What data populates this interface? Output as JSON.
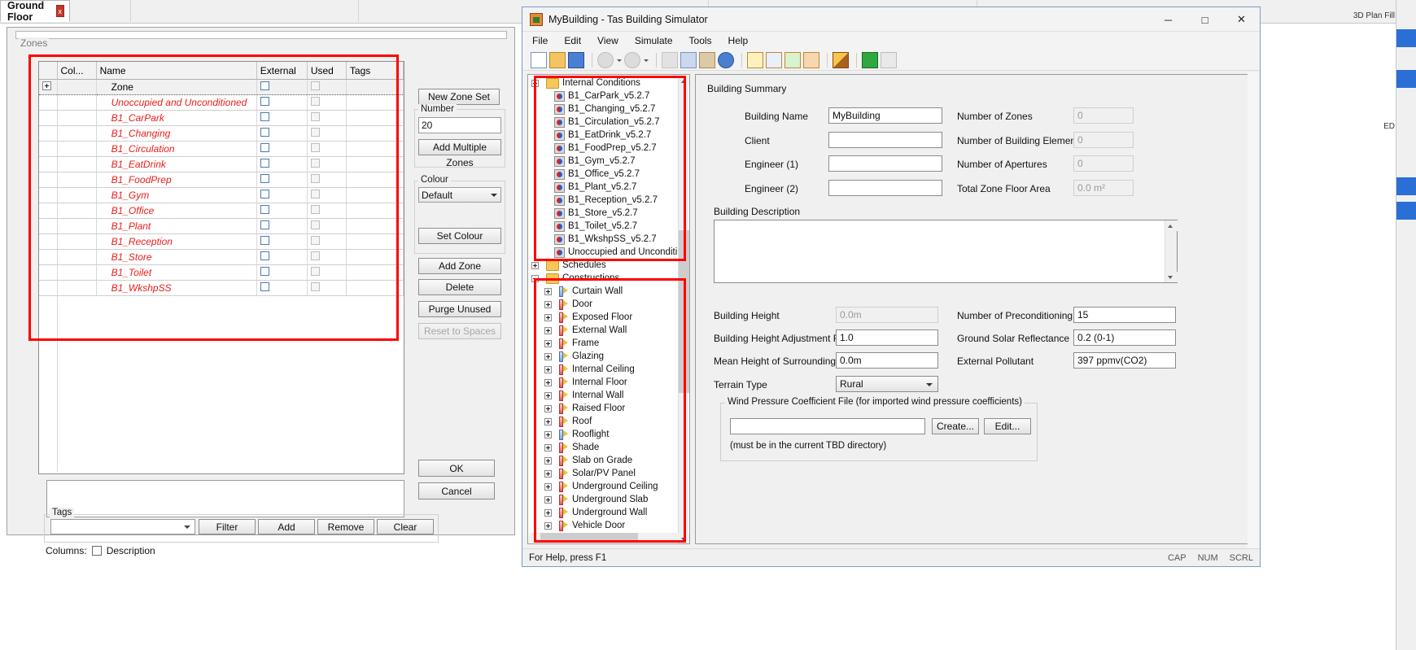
{
  "background": {
    "tab": {
      "label": "Ground Floor",
      "close_icon": "close-icon",
      "close_label": "x"
    },
    "right_strip": {
      "label_top": "3D Plan Fill",
      "label_mid": "ED"
    }
  },
  "zones_dialog": {
    "group_label": "Zones",
    "grid": {
      "columns": [
        "",
        "Col...",
        "Name",
        "External",
        "Used",
        "Tags"
      ],
      "rows": [
        {
          "name": "Zone",
          "root": true,
          "external": false,
          "used": false,
          "tags": ""
        },
        {
          "name": "Unoccupied and Unconditioned",
          "root": false,
          "external": false,
          "used": false,
          "tags": ""
        },
        {
          "name": "B1_CarPark",
          "root": false,
          "external": false,
          "used": false,
          "tags": ""
        },
        {
          "name": "B1_Changing",
          "root": false,
          "external": false,
          "used": false,
          "tags": ""
        },
        {
          "name": "B1_Circulation",
          "root": false,
          "external": false,
          "used": false,
          "tags": ""
        },
        {
          "name": "B1_EatDrink",
          "root": false,
          "external": false,
          "used": false,
          "tags": ""
        },
        {
          "name": "B1_FoodPrep",
          "root": false,
          "external": false,
          "used": false,
          "tags": ""
        },
        {
          "name": "B1_Gym",
          "root": false,
          "external": false,
          "used": false,
          "tags": ""
        },
        {
          "name": "B1_Office",
          "root": false,
          "external": false,
          "used": false,
          "tags": ""
        },
        {
          "name": "B1_Plant",
          "root": false,
          "external": false,
          "used": false,
          "tags": ""
        },
        {
          "name": "B1_Reception",
          "root": false,
          "external": false,
          "used": false,
          "tags": ""
        },
        {
          "name": "B1_Store",
          "root": false,
          "external": false,
          "used": false,
          "tags": ""
        },
        {
          "name": "B1_Toilet",
          "root": false,
          "external": false,
          "used": false,
          "tags": ""
        },
        {
          "name": "B1_WkshpSS",
          "root": false,
          "external": false,
          "used": false,
          "tags": ""
        }
      ]
    },
    "side": {
      "new_zone_set": "New Zone Set",
      "number_group": "Number",
      "number_value": "20",
      "add_multiple_zones": "Add Multiple Zones",
      "colour_group": "Colour",
      "colour_value": "Default",
      "set_colour": "Set Colour",
      "add_zone": "Add Zone",
      "delete": "Delete",
      "purge_unused": "Purge Unused",
      "reset_to_spaces": "Reset to Spaces",
      "ok": "OK",
      "cancel": "Cancel"
    },
    "tags": {
      "group_label": "Tags",
      "value": "",
      "filter": "Filter",
      "add": "Add",
      "remove": "Remove",
      "clear": "Clear"
    },
    "columns_row": {
      "label": "Columns:",
      "description": "Description",
      "checked": false
    }
  },
  "tas_window": {
    "title": "MyBuilding - Tas Building Simulator",
    "app_icon": "building-icon",
    "window_buttons": {
      "minimize": "─",
      "maximize": "□",
      "close": "✕"
    },
    "menu": [
      "File",
      "Edit",
      "View",
      "Simulate",
      "Tools",
      "Help"
    ],
    "toolbar_icons": [
      "new-document-icon",
      "open-folder-icon",
      "save-disk-icon",
      "back-arrow-icon",
      "forward-arrow-icon",
      "cut-scissors-icon",
      "copy-icon",
      "paste-icon",
      "help-globe-icon",
      "internal-conditions-icon",
      "schedule-edit-icon",
      "calendar-icon",
      "constructions-icon",
      "zones-icon",
      "building-3d-icon",
      "rotate-icon"
    ],
    "tree": {
      "nodes": [
        {
          "label": "Internal Conditions",
          "type": "folder",
          "expanded": true,
          "depth": 0
        },
        {
          "label": "B1_CarPark_v5.2.7",
          "type": "condition",
          "depth": 1
        },
        {
          "label": "B1_Changing_v5.2.7",
          "type": "condition",
          "depth": 1
        },
        {
          "label": "B1_Circulation_v5.2.7",
          "type": "condition",
          "depth": 1
        },
        {
          "label": "B1_EatDrink_v5.2.7",
          "type": "condition",
          "depth": 1
        },
        {
          "label": "B1_FoodPrep_v5.2.7",
          "type": "condition",
          "depth": 1
        },
        {
          "label": "B1_Gym_v5.2.7",
          "type": "condition",
          "depth": 1
        },
        {
          "label": "B1_Office_v5.2.7",
          "type": "condition",
          "depth": 1
        },
        {
          "label": "B1_Plant_v5.2.7",
          "type": "condition",
          "depth": 1
        },
        {
          "label": "B1_Reception_v5.2.7",
          "type": "condition",
          "depth": 1
        },
        {
          "label": "B1_Store_v5.2.7",
          "type": "condition",
          "depth": 1
        },
        {
          "label": "B1_Toilet_v5.2.7",
          "type": "condition",
          "depth": 1
        },
        {
          "label": "B1_WkshpSS_v5.2.7",
          "type": "condition",
          "depth": 1
        },
        {
          "label": "Unoccupied and Unconditi",
          "type": "condition",
          "depth": 1
        },
        {
          "label": "Schedules",
          "type": "folder",
          "depth": 0
        },
        {
          "label": "Constructions",
          "type": "folder",
          "expanded": true,
          "depth": 0
        },
        {
          "label": "Curtain Wall",
          "type": "glazing",
          "collapsed": true,
          "depth": 1
        },
        {
          "label": "Door",
          "type": "opaque",
          "collapsed": true,
          "depth": 1
        },
        {
          "label": "Exposed Floor",
          "type": "opaque",
          "collapsed": true,
          "depth": 1
        },
        {
          "label": "External Wall",
          "type": "opaque",
          "collapsed": true,
          "depth": 1
        },
        {
          "label": "Frame",
          "type": "opaque",
          "collapsed": true,
          "depth": 1
        },
        {
          "label": "Glazing",
          "type": "glazing",
          "collapsed": true,
          "depth": 1
        },
        {
          "label": "Internal Ceiling",
          "type": "opaque",
          "collapsed": true,
          "depth": 1
        },
        {
          "label": "Internal Floor",
          "type": "opaque",
          "collapsed": true,
          "depth": 1
        },
        {
          "label": "Internal Wall",
          "type": "opaque",
          "collapsed": true,
          "depth": 1
        },
        {
          "label": "Raised Floor",
          "type": "opaque",
          "collapsed": true,
          "depth": 1
        },
        {
          "label": "Roof",
          "type": "opaque",
          "collapsed": true,
          "depth": 1
        },
        {
          "label": "Rooflight",
          "type": "glazing",
          "collapsed": true,
          "depth": 1
        },
        {
          "label": "Shade",
          "type": "opaque",
          "collapsed": true,
          "depth": 1
        },
        {
          "label": "Slab on Grade",
          "type": "opaque",
          "collapsed": true,
          "depth": 1
        },
        {
          "label": "Solar/PV Panel",
          "type": "opaque",
          "collapsed": true,
          "depth": 1
        },
        {
          "label": "Underground Ceiling",
          "type": "opaque",
          "collapsed": true,
          "depth": 1
        },
        {
          "label": "Underground Slab",
          "type": "opaque",
          "collapsed": true,
          "depth": 1
        },
        {
          "label": "Underground Wall",
          "type": "opaque",
          "collapsed": true,
          "depth": 1
        },
        {
          "label": "Vehicle Door",
          "type": "opaque",
          "collapsed": true,
          "depth": 1
        }
      ]
    },
    "summary": {
      "title": "Building Summary",
      "building_name_label": "Building Name",
      "building_name_value": "MyBuilding",
      "client_label": "Client",
      "client_value": "",
      "engineer1_label": "Engineer (1)",
      "engineer1_value": "",
      "engineer2_label": "Engineer (2)",
      "engineer2_value": "",
      "number_of_zones_label": "Number of Zones",
      "number_of_zones_value": "0",
      "number_of_building_elements_label": "Number of Building Elements",
      "number_of_building_elements_value": "0",
      "number_of_apertures_label": "Number of Apertures",
      "number_of_apertures_value": "0",
      "total_zone_floor_area_label": "Total Zone Floor Area",
      "total_zone_floor_area_value": "0.0 m²",
      "building_description_label": "Building Description",
      "building_description_value": "",
      "building_height_label": "Building Height",
      "building_height_value": "0.0m",
      "height_adjust_label": "Building Height Adjustment Factor",
      "height_adjust_value": "1.0",
      "mean_height_label": "Mean Height of Surroundings",
      "mean_height_value": "0.0m",
      "terrain_type_label": "Terrain Type",
      "terrain_type_value": "Rural",
      "preconditioning_days_label": "Number of Preconditioning Days",
      "preconditioning_days_value": "15",
      "ground_solar_label": "Ground Solar Reflectance",
      "ground_solar_value": "0.2 (0-1)",
      "external_pollutant_label": "External Pollutant",
      "external_pollutant_value": "397 ppmv(CO2)",
      "wpc_group_label": "Wind Pressure Coefficient File (for imported wind pressure coefficients)",
      "wpc_value": "",
      "wpc_create": "Create...",
      "wpc_edit": "Edit...",
      "wpc_hint": "(must be in the current TBD directory)"
    },
    "status_bar": {
      "message": "For Help, press F1",
      "indicators": [
        "CAP",
        "NUM",
        "SCRL"
      ]
    }
  }
}
